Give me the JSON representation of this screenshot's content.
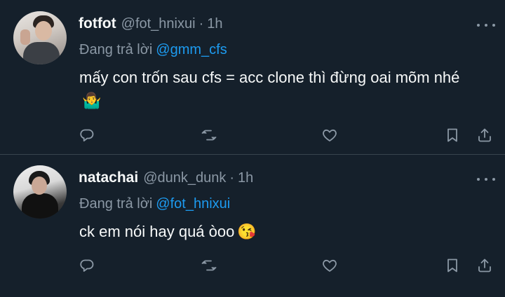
{
  "theme": {
    "background": "#15202b",
    "text": "#f7f9f9",
    "muted": "#8b98a5",
    "accent": "#1d9bf0",
    "divider": "#38444d"
  },
  "tweets": [
    {
      "name": "fotfot",
      "handle": "@fot_hnixui",
      "separator": "·",
      "time": "1h",
      "replying_prefix": "Đang trả lời",
      "replying_to": "@gmm_cfs",
      "text": "mấy con trốn sau cfs = acc clone thì đừng oai mõm nhé",
      "emoji": "🤷‍♂️"
    },
    {
      "name": "natachai",
      "handle": "@dunk_dunk",
      "separator": "·",
      "time": "1h",
      "replying_prefix": "Đang trả lời",
      "replying_to": "@fot_hnixui",
      "text": "ck em nói hay quá òoo",
      "emoji": "😘"
    }
  ],
  "icons": {
    "more": "more-horizontal-icon",
    "reply": "reply-icon",
    "retweet": "retweet-icon",
    "like": "heart-icon",
    "bookmark": "bookmark-icon",
    "share": "share-icon"
  }
}
